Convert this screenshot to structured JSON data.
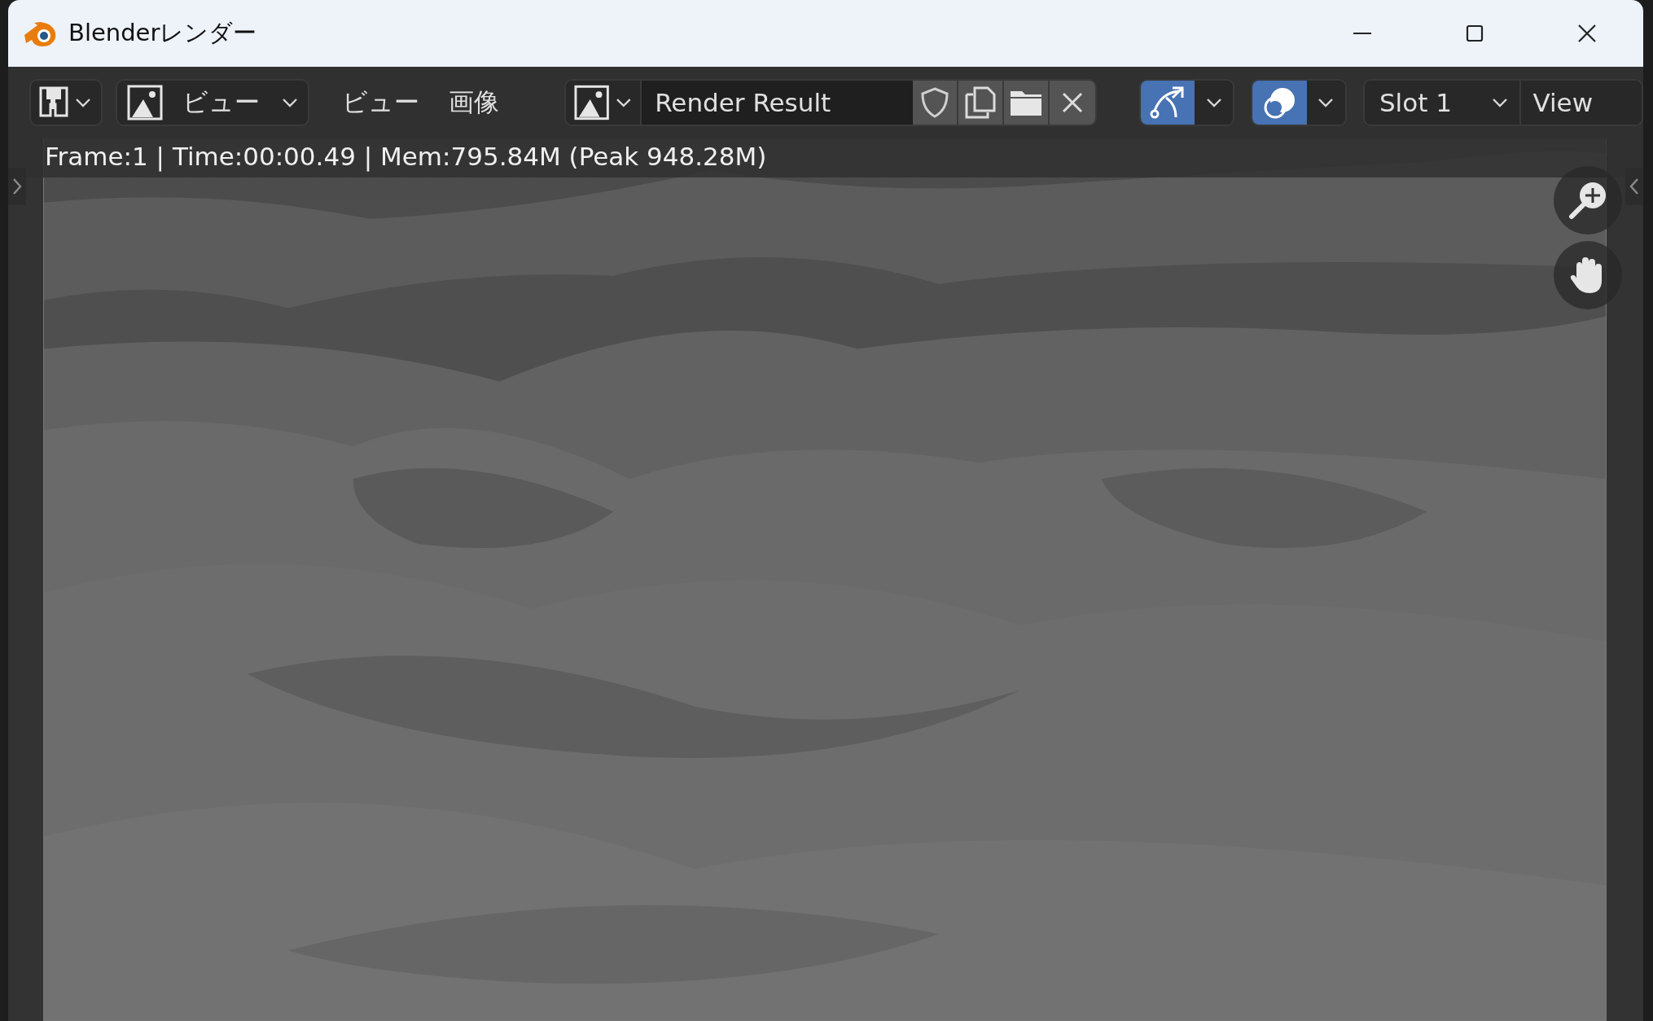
{
  "window": {
    "title": "Blenderレンダー"
  },
  "toolbar": {
    "view_mode": {
      "label": "ビュー"
    },
    "menus": [
      {
        "label": "ビュー"
      },
      {
        "label": "画像"
      }
    ],
    "image_name": {
      "value": "Render Result"
    },
    "toggles": [
      {
        "kind": "gizmo",
        "on": true
      },
      {
        "kind": "overlay",
        "on": true
      }
    ],
    "slot": {
      "value": "Slot 1"
    },
    "view_layer": {
      "value": "View"
    }
  },
  "viewer": {
    "info": "Frame:1 | Time:00:00.49 | Mem:795.84M (Peak 948.28M)"
  }
}
